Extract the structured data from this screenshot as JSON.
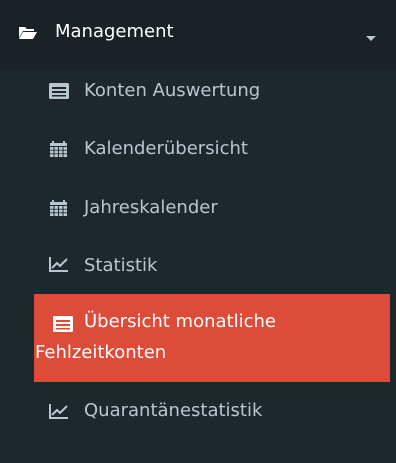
{
  "section": {
    "label": "Management",
    "icon": "folder-open-icon",
    "caret_icon": "caret-down-icon"
  },
  "items": [
    {
      "label": "Konten Auswertung",
      "icon": "list-alt-icon"
    },
    {
      "label": "Kalenderübersicht",
      "icon": "calendar-icon"
    },
    {
      "label": "Jahreskalender",
      "icon": "calendar-icon"
    },
    {
      "label": "Statistik",
      "icon": "line-chart-icon"
    },
    {
      "label_line1": "Übersicht monatliche",
      "label_line2": "Fehlzeitkonten",
      "icon": "list-alt-icon",
      "active": true
    },
    {
      "label": "Quarantänestatistik",
      "icon": "line-chart-icon"
    }
  ],
  "colors": {
    "sidebar_bg": "#1e282c",
    "header_bg": "#1a2226",
    "text": "#b8c7ce",
    "active_bg": "#dd4b39",
    "active_text": "#ffffff"
  }
}
